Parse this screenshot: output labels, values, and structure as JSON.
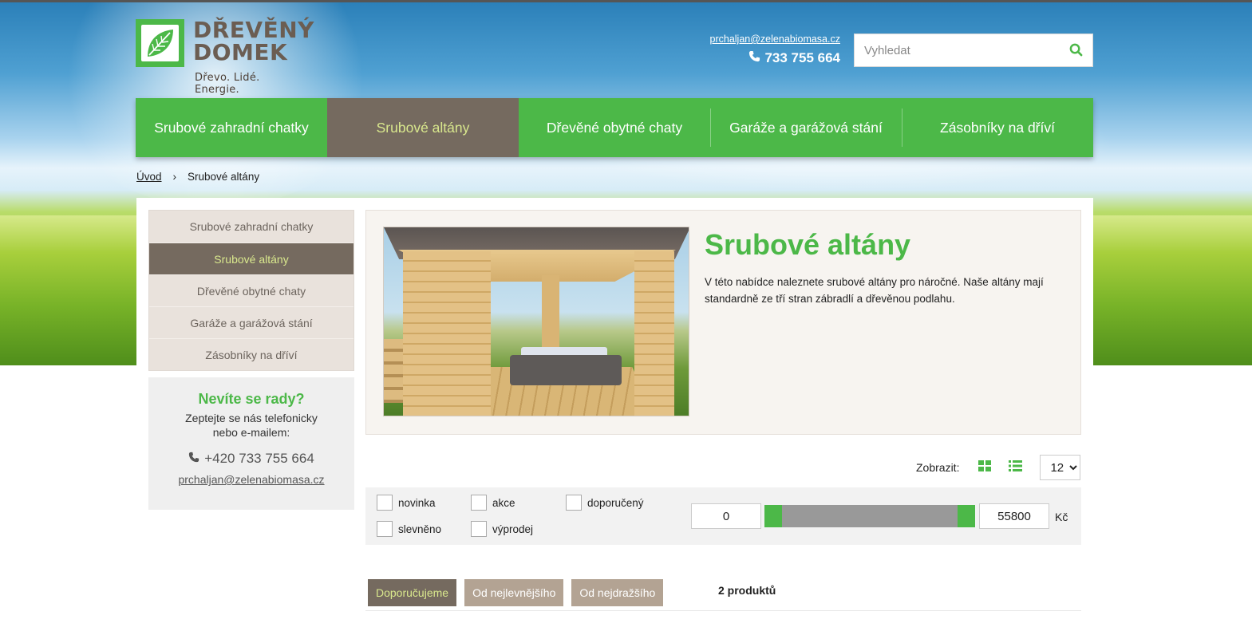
{
  "logo": {
    "name_line1": "DŘEVĚNÝ",
    "name_line2": "DOMEK",
    "tagline": "Dřevo. Lidé. Energie."
  },
  "contact": {
    "email": "prchaljan@zelenabiomasa.cz",
    "phone": "733 755 664"
  },
  "search": {
    "placeholder": "Vyhledat"
  },
  "mainnav": [
    {
      "label": "Srubové zahradní chatky",
      "active": false
    },
    {
      "label": "Srubové altány",
      "active": true
    },
    {
      "label": "Dřevěné obytné chaty",
      "active": false
    },
    {
      "label": "Garáže a garážová stání",
      "active": false
    },
    {
      "label": "Zásobníky na dříví",
      "active": false
    }
  ],
  "breadcrumb": {
    "home": "Úvod",
    "separator": "›",
    "current": "Srubové altány"
  },
  "sidebar": {
    "items": [
      {
        "label": "Srubové zahradní chatky"
      },
      {
        "label": "Srubové altány"
      },
      {
        "label": "Dřevěné obytné chaty"
      },
      {
        "label": "Garáže a garážová stání"
      },
      {
        "label": "Zásobníky na dříví"
      }
    ],
    "help": {
      "title": "Nevíte se rady?",
      "text_line1": "Zeptejte se nás telefonicky",
      "text_line2": "nebo e-mailem:",
      "phone": "+420 733 755 664",
      "email": "prchaljan@zelenabiomasa.cz"
    }
  },
  "category": {
    "title": "Srubové altány",
    "description": "V této nabídce naleznete srubové altány pro náročné. Naše altány mají standardně ze tří stran zábradlí a dřevěnou podlahu."
  },
  "display": {
    "label": "Zobrazit:",
    "per_page": "12"
  },
  "filters": {
    "checkboxes": [
      {
        "label": "novinka"
      },
      {
        "label": "akce"
      },
      {
        "label": "doporučený"
      },
      {
        "label": "slevněno"
      },
      {
        "label": "výprodej"
      }
    ],
    "price_from": "0",
    "price_to": "55800",
    "currency": "Kč"
  },
  "sorting": {
    "buttons": [
      {
        "label": "Doporučujeme",
        "active": true
      },
      {
        "label": "Od nejlevnějšího",
        "active": false
      },
      {
        "label": "Od nejdražšího",
        "active": false
      }
    ],
    "count": "2 produktů"
  },
  "colors": {
    "brand_green": "#4cb848",
    "active_brown": "#756a5f",
    "active_text": "#d9e88d",
    "sort_tan": "#b3a393"
  }
}
